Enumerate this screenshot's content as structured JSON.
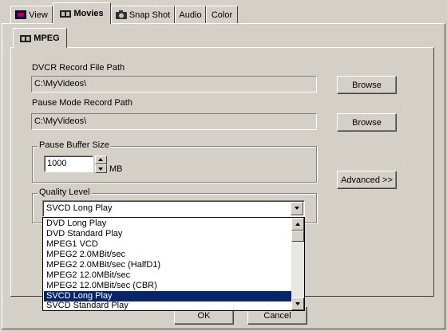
{
  "tabs": [
    {
      "label": "View",
      "icon": "tv-icon"
    },
    {
      "label": "Movies",
      "icon": "film-icon"
    },
    {
      "label": "Snap Shot",
      "icon": "camera-icon"
    },
    {
      "label": "Audio"
    },
    {
      "label": "Color"
    }
  ],
  "active_tab": "Movies",
  "subtab": {
    "label": "MPEG",
    "icon": "film-icon"
  },
  "dvcr": {
    "label": "DVCR Record File Path",
    "value": "C:\\MyVideos\\",
    "browse_label": "Browse"
  },
  "pause_path": {
    "label": "Pause Mode Record Path",
    "value": "C:\\MyVideos\\",
    "browse_label": "Browse"
  },
  "pause_buffer": {
    "title": "Pause Buffer Size",
    "value": "1000",
    "unit": "MB"
  },
  "advanced_label": "Advanced >>",
  "quality": {
    "title": "Quality Level",
    "selected": "SVCD Long Play",
    "options": [
      "DVD Long Play",
      "DVD Standard Play",
      "MPEG1 VCD",
      "MPEG2  2.0MBit/sec",
      "MPEG2  2.0MBit/sec (HalfD1)",
      "MPEG2 12.0MBit/sec",
      "MPEG2 12.0MBit/sec (CBR)",
      "SVCD Long Play",
      "SVCD Standard Play"
    ],
    "highlighted_index": 7
  },
  "footer": {
    "ok_label": "OK",
    "cancel_label": "Cancel"
  },
  "colors": {
    "face": "#d4d0c8",
    "selection": "#0a246a",
    "shadow": "#808080",
    "highlight": "#ffffff"
  }
}
